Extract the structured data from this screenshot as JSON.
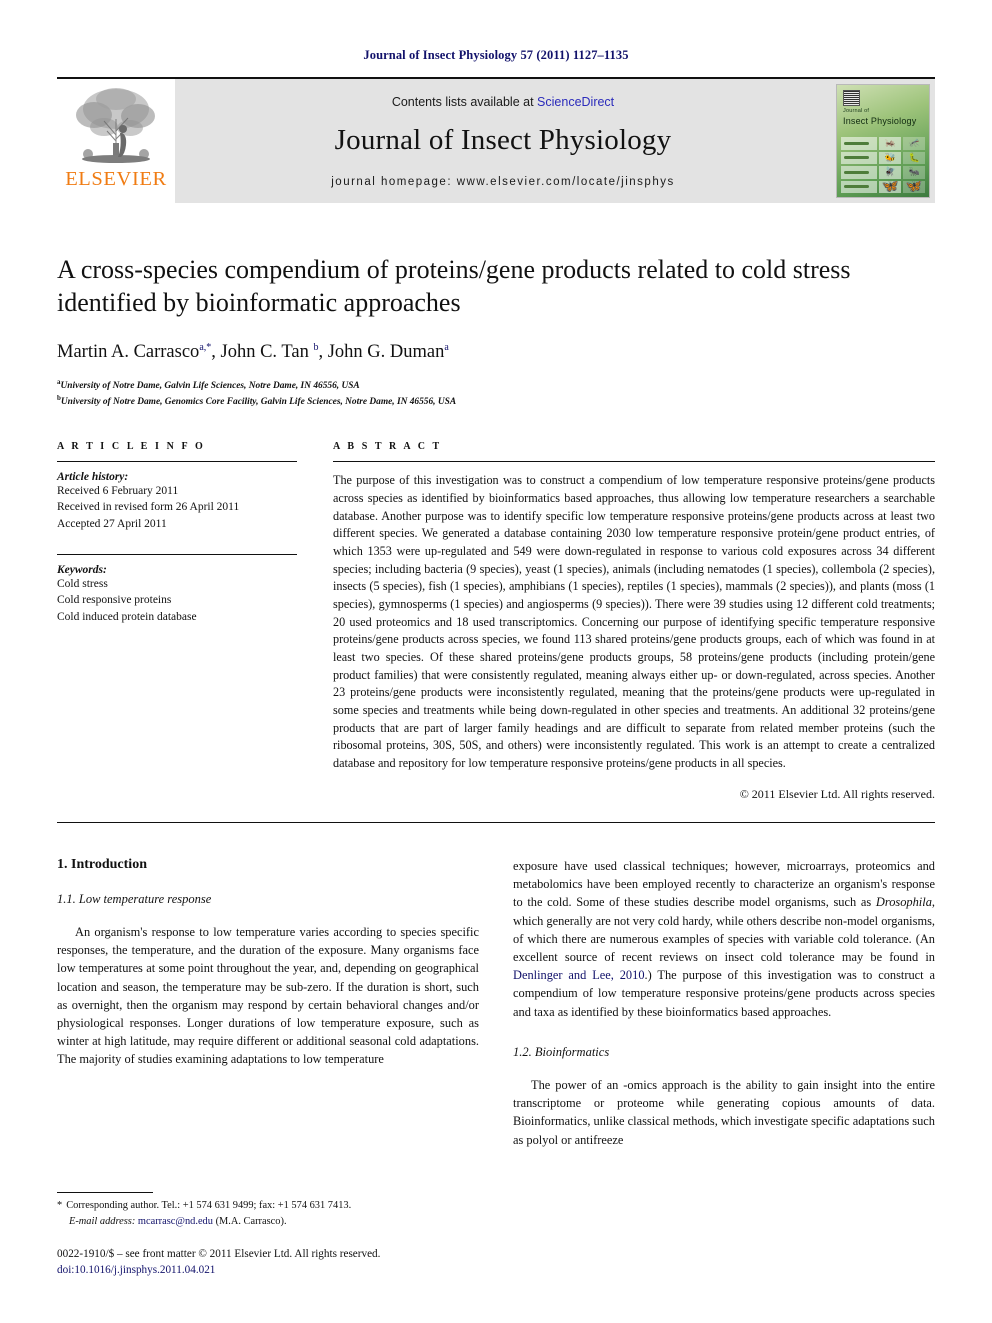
{
  "running_head": "Journal of Insect Physiology 57 (2011) 1127–1135",
  "masthead": {
    "contents_prefix": "Contents lists available at",
    "sciencedirect": "ScienceDirect",
    "journal_name": "Journal of Insect Physiology",
    "homepage": "journal homepage: www.elsevier.com/locate/jinsphys",
    "publisher": "ELSEVIER",
    "cover": {
      "line1": "Journal of",
      "line2": "Insect Physiology"
    },
    "colors": {
      "elsevier_orange": "#f07c13",
      "banner_gray": "#e3e3e3",
      "link_blue": "#2b2bbb",
      "navy": "#12126b"
    }
  },
  "article": {
    "title": "A cross-species compendium of proteins/gene products related to cold stress identified by bioinformatic approaches",
    "authors_html": "Martin A. Carrasco<sup>a,*</sup>, John C. Tan <sup>b</sup>, John G. Duman<sup>a</sup>",
    "affiliations": [
      {
        "marker": "a",
        "text": "University of Notre Dame, Galvin Life Sciences, Notre Dame, IN 46556, USA"
      },
      {
        "marker": "b",
        "text": "University of Notre Dame, Genomics Core Facility, Galvin Life Sciences, Notre Dame, IN 46556, USA"
      }
    ]
  },
  "info": {
    "label": "A R T I C L E   I N F O",
    "history_head": "Article history:",
    "history": [
      "Received 6 February 2011",
      "Received in revised form 26 April 2011",
      "Accepted 27 April 2011"
    ],
    "keywords_head": "Keywords:",
    "keywords": [
      "Cold stress",
      "Cold responsive proteins",
      "Cold induced protein database"
    ]
  },
  "abstract": {
    "label": "A B S T R A C T",
    "text": "The purpose of this investigation was to construct a compendium of low temperature responsive proteins/gene products across species as identified by bioinformatics based approaches, thus allowing low temperature researchers a searchable database. Another purpose was to identify specific low temperature responsive proteins/gene products across at least two different species. We generated a database containing 2030 low temperature responsive protein/gene product entries, of which 1353 were up-regulated and 549 were down-regulated in response to various cold exposures across 34 different species; including bacteria (9 species), yeast (1 species), animals (including nematodes (1 species), collembola (2 species), insects (5 species), fish (1 species), amphibians (1 species), reptiles (1 species), mammals (2 species)), and plants (moss (1 species), gymnosperms (1 species) and angiosperms (9 species)). There were 39 studies using 12 different cold treatments; 20 used proteomics and 18 used transcriptomics. Concerning our purpose of identifying specific temperature responsive proteins/gene products across species, we found 113 shared proteins/gene products groups, each of which was found in at least two species. Of these shared proteins/gene products groups, 58 proteins/gene products (including protein/gene product families) that were consistently regulated, meaning always either up- or down-regulated, across species. Another 23 proteins/gene products were inconsistently regulated, meaning that the proteins/gene products were up-regulated in some species and treatments while being down-regulated in other species and treatments. An additional 32 proteins/gene products that are part of larger family headings and are difficult to separate from related member proteins (such the ribosomal proteins, 30S, 50S, and others) were inconsistently regulated. This work is an attempt to create a centralized database and repository for low temperature responsive proteins/gene products in all species.",
    "copyright": "© 2011 Elsevier Ltd. All rights reserved."
  },
  "body": {
    "section_1": "1. Introduction",
    "subsection_1_1": "1.1. Low temperature response",
    "para_left_1": "An organism's response to low temperature varies according to species specific responses, the temperature, and the duration of the exposure. Many organisms face low temperatures at some point throughout the year, and, depending on geographical location and season, the temperature may be sub-zero. If the duration is short, such as overnight, then the organism may respond by certain behavioral changes and/or physiological responses. Longer durations of low temperature exposure, such as winter at high latitude, may require different or additional seasonal cold adaptations. The majority of studies examining adaptations to low temperature",
    "para_right_1_a": "exposure have used classical techniques; however, microarrays, proteomics and metabolomics have been employed recently to characterize an organism's response to the cold. Some of these studies describe model organisms, such as ",
    "para_right_1_italic": "Drosophila",
    "para_right_1_b": ", which generally are not very cold hardy, while others describe non-model organisms, of which there are numerous examples of species with variable cold tolerance. (An excellent source of recent reviews on insect cold tolerance may be found in ",
    "para_right_1_cite": "Denlinger and Lee, 2010",
    "para_right_1_c": ".) The purpose of this investigation was to construct a compendium of low temperature responsive proteins/gene products across species and taxa as identified by these bioinformatics based approaches.",
    "subsection_1_2": "1.2. Bioinformatics",
    "para_right_2": "The power of an -omics approach is the ability to gain insight into the entire transcriptome or proteome while generating copious amounts of data. Bioinformatics, unlike classical methods, which investigate specific adaptations such as polyol or antifreeze"
  },
  "footer": {
    "corresponding_marker": "*",
    "corresponding": "Corresponding author. Tel.: +1 574 631 9499; fax: +1 574 631 7413.",
    "email_label": "E-mail address:",
    "email": "mcarrasc@nd.edu",
    "email_suffix": "(M.A. Carrasco).",
    "front_matter": "0022-1910/$ – see front matter © 2011 Elsevier Ltd. All rights reserved.",
    "doi": "doi:10.1016/j.jinsphys.2011.04.021"
  }
}
